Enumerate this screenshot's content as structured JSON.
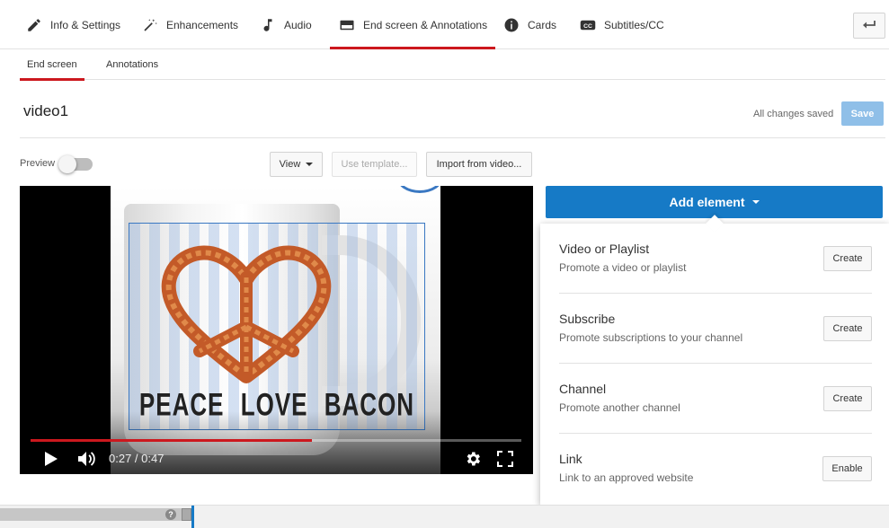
{
  "top_tabs": [
    {
      "label": "Info & Settings",
      "icon": "pencil-icon"
    },
    {
      "label": "Enhancements",
      "icon": "magic-wand-icon"
    },
    {
      "label": "Audio",
      "icon": "music-note-icon"
    },
    {
      "label": "End screen & Annotations",
      "icon": "end-screen-icon",
      "active": true
    },
    {
      "label": "Cards",
      "icon": "info-icon"
    },
    {
      "label": "Subtitles/CC",
      "icon": "cc-icon"
    }
  ],
  "sub_tabs": [
    {
      "label": "End screen",
      "active": true
    },
    {
      "label": "Annotations"
    }
  ],
  "video": {
    "title": "video1",
    "saved_status": "All changes saved",
    "save_label": "Save",
    "frame_text": "PEACE LOVE BACON"
  },
  "toolbar": {
    "preview_label": "Preview",
    "preview_on": false,
    "view_label": "View",
    "template_label": "Use template...",
    "import_label": "Import from video..."
  },
  "player": {
    "current_time": "0:27",
    "duration": "0:47",
    "time_display": "0:27 / 0:47",
    "progress_fraction": 0.574
  },
  "add_element": {
    "label": "Add element",
    "items": [
      {
        "title": "Video or Playlist",
        "desc": "Promote a video or playlist",
        "button": "Create"
      },
      {
        "title": "Subscribe",
        "desc": "Promote subscriptions to your channel",
        "button": "Create"
      },
      {
        "title": "Channel",
        "desc": "Promote another channel",
        "button": "Create"
      },
      {
        "title": "Link",
        "desc": "Link to an approved website",
        "button": "Enable"
      }
    ]
  },
  "timeline": {
    "help_label": "?"
  },
  "colors": {
    "accent_red": "#cc181e",
    "accent_blue": "#167ac6",
    "save_disabled": "#8fbfe8"
  }
}
